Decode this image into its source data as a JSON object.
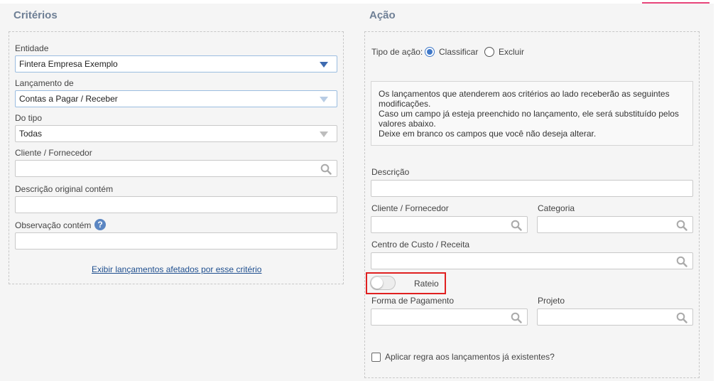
{
  "criterios": {
    "title": "Critérios",
    "entidade_label": "Entidade",
    "entidade_value": "Fintera Empresa Exemplo",
    "lancamento_label": "Lançamento de",
    "lancamento_value": "Contas a Pagar / Receber",
    "tipo_label": "Do tipo",
    "tipo_value": "Todas",
    "cliente_label": "Cliente / Fornecedor",
    "cliente_value": "",
    "descricao_label": "Descrição original contém",
    "descricao_value": "",
    "observacao_label": "Observação contém",
    "observacao_value": "",
    "help_glyph": "?",
    "exibir_link": "Exibir lançamentos afetados por esse critério"
  },
  "acao": {
    "title": "Ação",
    "tipo_acao_label": "Tipo de ação:",
    "opt_classificar": "Classificar",
    "opt_excluir": "Excluir",
    "selected_option": "Classificar",
    "info_lines": [
      "Os lançamentos que atenderem aos critérios ao lado receberão as seguintes",
      "modificações.",
      "Caso um campo já esteja preenchido no lançamento, ele será substituído pelos",
      "valores abaixo.",
      "Deixe em branco os campos que você não deseja alterar."
    ],
    "descricao_label": "Descrição",
    "descricao_value": "",
    "cliente_label": "Cliente / Fornecedor",
    "categoria_label": "Categoria",
    "centro_label": "Centro de Custo / Receita",
    "rateio_label": "Rateio",
    "rateio_on": false,
    "forma_label": "Forma de Pagamento",
    "projeto_label": "Projeto",
    "aplicar_label": "Aplicar regra aos lançamentos já existentes?",
    "aplicar_checked": false
  },
  "colors": {
    "accent": "#3f78c8",
    "title": "#6e7f95",
    "highlight": "#e02020",
    "pink": "#e8457a"
  },
  "icons": {
    "search": "search-icon",
    "dropdown": "chevron-down-icon",
    "help": "help-icon"
  }
}
